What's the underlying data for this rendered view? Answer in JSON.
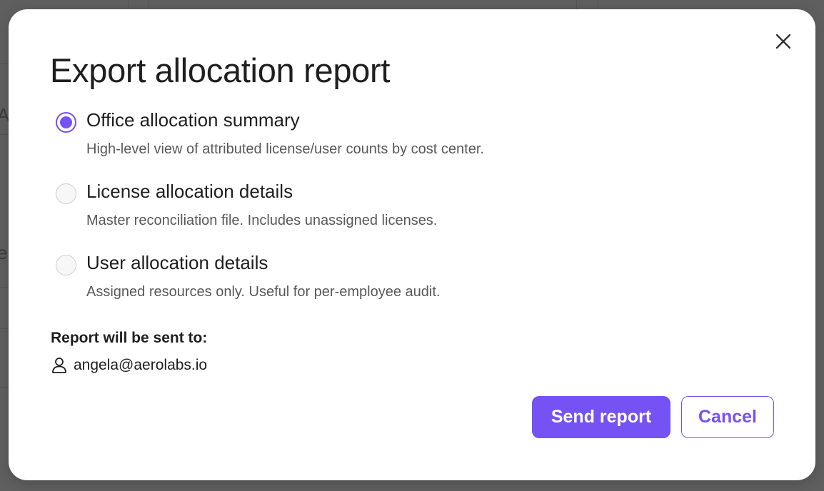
{
  "background": {
    "edge_glyph_top": "A",
    "edge_glyph_mid": "e"
  },
  "dialog": {
    "title": "Export allocation report",
    "close_icon": "close-icon",
    "options": [
      {
        "label": "Office allocation summary",
        "description": "High-level view of attributed license/user counts by cost center.",
        "selected": true
      },
      {
        "label": "License allocation details",
        "description": "Master reconciliation file. Includes unassigned licenses.",
        "selected": false
      },
      {
        "label": "User allocation details",
        "description": "Assigned resources only. Useful for per-employee audit.",
        "selected": false
      }
    ],
    "recipient": {
      "heading": "Report will be sent to:",
      "icon": "user-icon",
      "email": "angela@aerolabs.io"
    },
    "actions": {
      "send_label": "Send report",
      "cancel_label": "Cancel"
    }
  },
  "colors": {
    "accent": "#7552f4",
    "overlay": "#5f5f5f",
    "text_primary": "#1f1f1f",
    "text_secondary": "#595959"
  }
}
